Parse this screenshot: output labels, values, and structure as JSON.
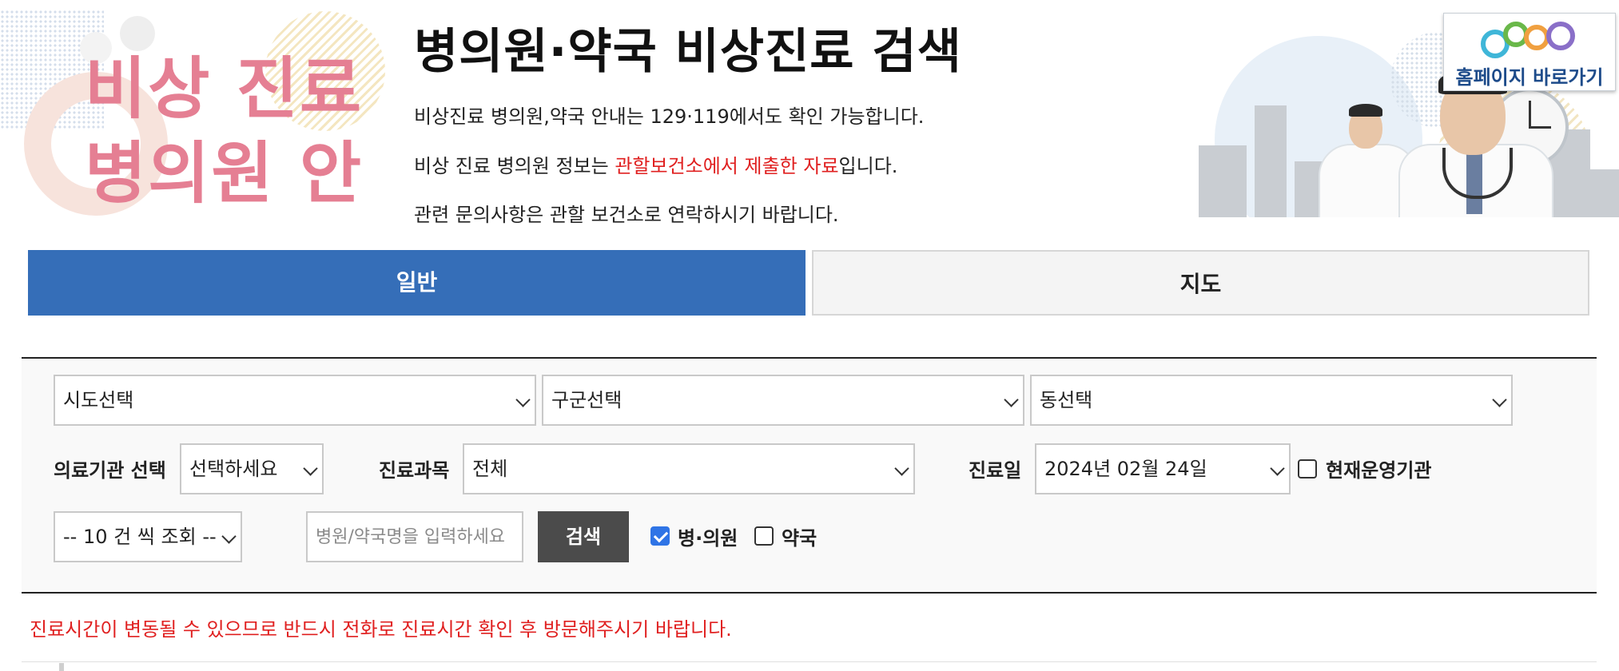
{
  "banner": {
    "title_line1": "비상 진료",
    "title_line2": "병의원 안내"
  },
  "header": {
    "title": "병의원·약국 비상진료 검색",
    "info_line1": "비상진료 병의원,약국 안내는 129·119에서도 확인 가능합니다.",
    "info_line2_prefix": "비상 진료 병의원 정보는 ",
    "info_line2_highlight": "관할보건소에서 제출한 자료",
    "info_line2_suffix": "입니다.",
    "info_line3": "관련 문의사항은 관할 보건소로 연락하시기 바랍니다."
  },
  "home_link": {
    "label": "홈페이지 바로가기"
  },
  "tabs": [
    {
      "label": "일반",
      "active": true
    },
    {
      "label": "지도",
      "active": false
    }
  ],
  "search": {
    "sido": "시도선택",
    "gugun": "구군선택",
    "dong": "동선택",
    "institution_label": "의료기관 선택",
    "institution_value": "선택하세요",
    "department_label": "진료과목",
    "department_value": "전체",
    "date_label": "진료일",
    "date_value": "2024년 02월 24일",
    "currently_open_label": "현재운영기관",
    "currently_open_checked": false,
    "page_size": "-- 10 건 씩 조회 --",
    "name_placeholder": "병원/약국명을 입력하세요",
    "name_value": "",
    "search_button": "검색",
    "hospital_label": "병·의원",
    "hospital_checked": true,
    "pharmacy_label": "약국",
    "pharmacy_checked": false
  },
  "notice": "진료시간이 변동될 수 있으므로 반드시 전화로 진료시간 확인 후 방문해주시기 바랍니다.",
  "colors": {
    "accent": "#356eb8",
    "highlight_red": "#e02020",
    "banner_pink": "#e57f93",
    "button_dark": "#4b4b4b",
    "checkbox_blue": "#2f74e6"
  }
}
